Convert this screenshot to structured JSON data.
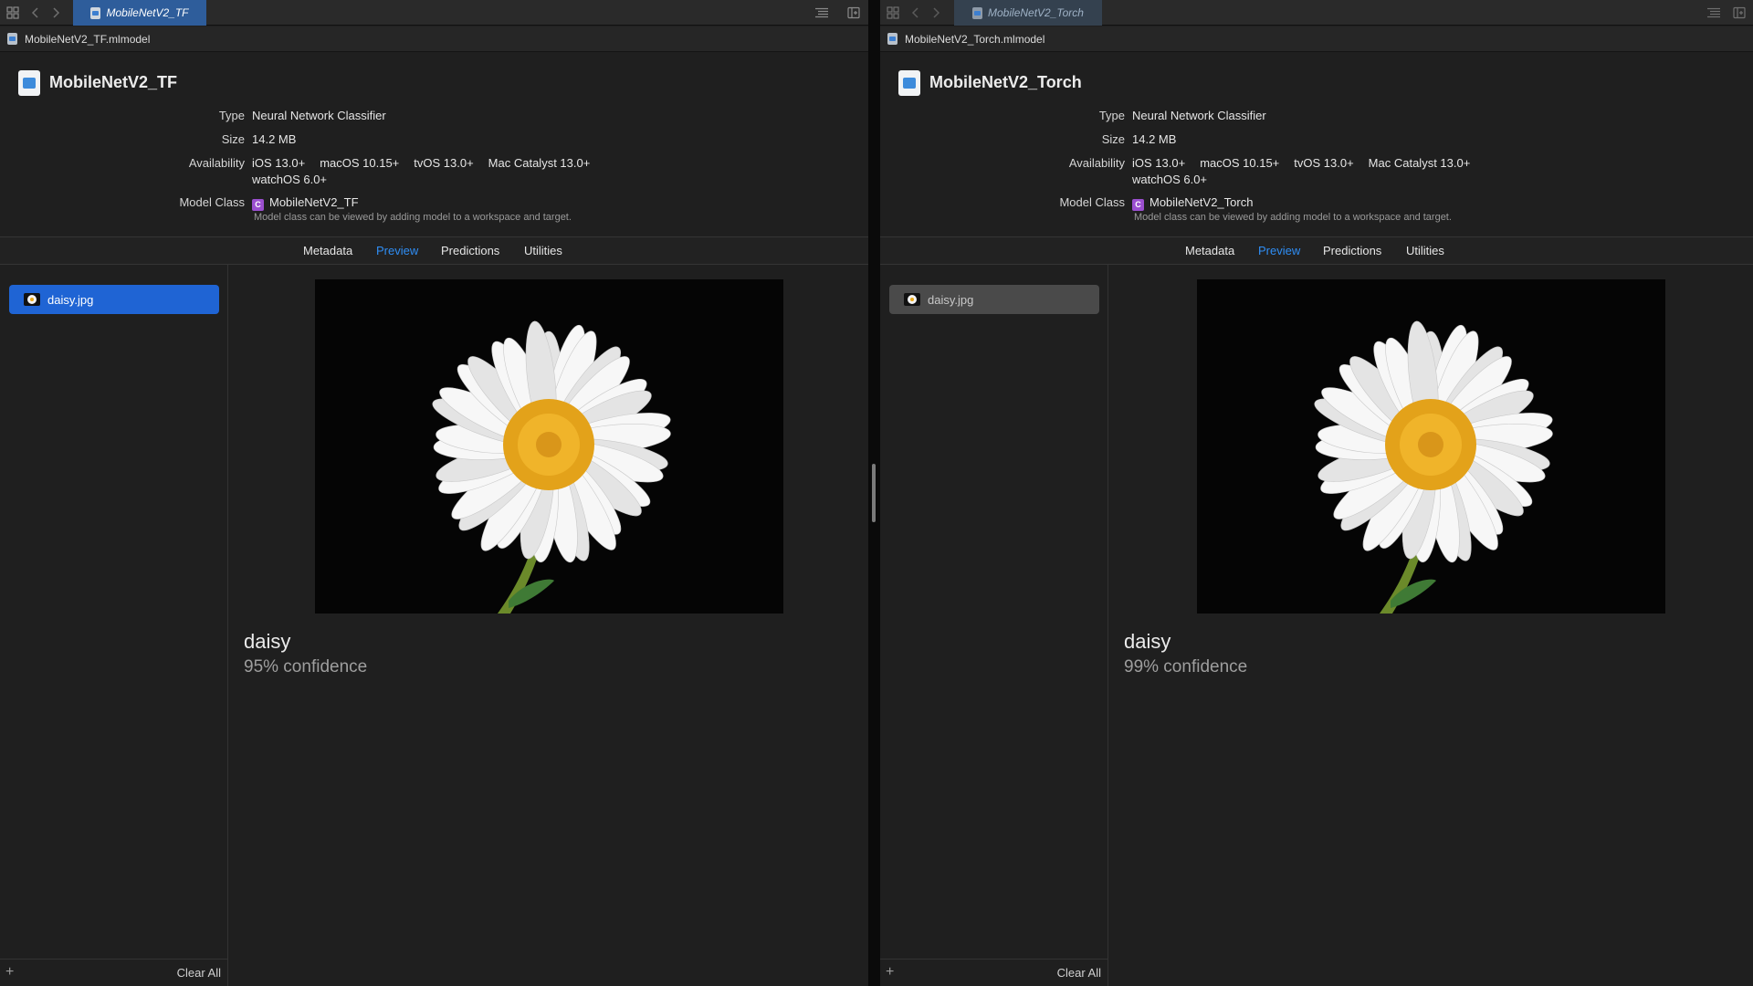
{
  "left": {
    "tab_title": "MobileNetV2_TF",
    "jump_file": "MobileNetV2_TF.mlmodel",
    "model_name": "MobileNetV2_TF",
    "type_label": "Type",
    "type_value": "Neural Network Classifier",
    "size_label": "Size",
    "size_value": "14.2 MB",
    "availability_label": "Availability",
    "availability": [
      "iOS 13.0+",
      "macOS 10.15+",
      "tvOS 13.0+",
      "Mac Catalyst 13.0+"
    ],
    "availability_line2": "watchOS 6.0+",
    "model_class_label": "Model Class",
    "class_badge": "C",
    "model_class_value": "MobileNetV2_TF",
    "class_note": "Model class can be viewed by adding model to a workspace and target.",
    "tabs": [
      "Metadata",
      "Preview",
      "Predictions",
      "Utilities"
    ],
    "active_tab": "Preview",
    "file_item": "daisy.jpg",
    "file_selected": true,
    "add_label": "+",
    "clear_all": "Clear All",
    "prediction_label": "daisy",
    "prediction_confidence": "95% confidence",
    "confidence_percent": 95
  },
  "right": {
    "tab_title": "MobileNetV2_Torch",
    "jump_file": "MobileNetV2_Torch.mlmodel",
    "model_name": "MobileNetV2_Torch",
    "type_label": "Type",
    "type_value": "Neural Network Classifier",
    "size_label": "Size",
    "size_value": "14.2 MB",
    "availability_label": "Availability",
    "availability": [
      "iOS 13.0+",
      "macOS 10.15+",
      "tvOS 13.0+",
      "Mac Catalyst 13.0+"
    ],
    "availability_line2": "watchOS 6.0+",
    "model_class_label": "Model Class",
    "class_badge": "C",
    "model_class_value": "MobileNetV2_Torch",
    "class_note": "Model class can be viewed by adding model to a workspace and target.",
    "tabs": [
      "Metadata",
      "Preview",
      "Predictions",
      "Utilities"
    ],
    "active_tab": "Preview",
    "file_item": "daisy.jpg",
    "file_selected": false,
    "add_label": "+",
    "clear_all": "Clear All",
    "prediction_label": "daisy",
    "prediction_confidence": "99% confidence",
    "confidence_percent": 99
  },
  "icons": {
    "grid": "grid-icon",
    "back": "chevron-left-icon",
    "forward": "chevron-right-icon",
    "lines": "editor-options-icon",
    "split": "split-editor-icon",
    "document": "document-icon",
    "model": "mlmodel-icon",
    "class": "class-icon",
    "add": "plus-icon",
    "image": "daisy-image"
  },
  "colors": {
    "accent": "#2f8ef5",
    "selection": "#1f64d4",
    "class_badge": "#9b4fcf",
    "active_tab": "#2e5d9b"
  }
}
